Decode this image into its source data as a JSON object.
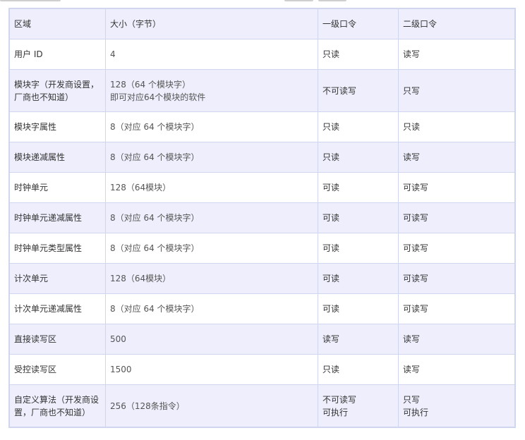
{
  "colors": {
    "header_bg": "#eeeefc",
    "border": "#cfd6ee",
    "text": "#333333"
  },
  "table": {
    "headers": [
      "区域",
      "大小（字节）",
      "一级口令",
      "二级口令"
    ],
    "rows": [
      {
        "area": "用户 ID",
        "size": "4",
        "size2": "",
        "level1": "只读",
        "level1b": "",
        "level2": "读写",
        "level2b": ""
      },
      {
        "area": "模块字（开发商设置，厂商也不知道）",
        "size": "128（64 个模块字）",
        "size2": "即可对应64个模块的软件",
        "level1": "不可读写",
        "level1b": "",
        "level2": "只写",
        "level2b": ""
      },
      {
        "area": "模块字属性",
        "size": "8（对应 64 个模块字）",
        "size2": "",
        "level1": "只读",
        "level1b": "",
        "level2": "只读",
        "level2b": ""
      },
      {
        "area": "模块递减属性",
        "size": "8（对应 64 个模块字）",
        "size2": "",
        "level1": "只读",
        "level1b": "",
        "level2": "读写",
        "level2b": ""
      },
      {
        "area": "时钟单元",
        "size": "128（64模块）",
        "size2": "",
        "level1": "可读",
        "level1b": "",
        "level2": "可读写",
        "level2b": ""
      },
      {
        "area": "时钟单元递减属性",
        "size": "8（对应 64 个模块字）",
        "size2": "",
        "level1": "可读",
        "level1b": "",
        "level2": "可读写",
        "level2b": ""
      },
      {
        "area": "时钟单元类型属性",
        "size": "8（对应 64 个模块字）",
        "size2": "",
        "level1": "可读",
        "level1b": "",
        "level2": "可读写",
        "level2b": ""
      },
      {
        "area": "计次单元",
        "size": "128（64模块）",
        "size2": "",
        "level1": "可读",
        "level1b": "",
        "level2": "可读写",
        "level2b": ""
      },
      {
        "area": "计次单元递减属性",
        "size": "8（对应 64 个模块字）",
        "size2": "",
        "level1": "可读",
        "level1b": "",
        "level2": "可读写",
        "level2b": ""
      },
      {
        "area": "直接读写区",
        "size": "500",
        "size2": "",
        "level1": "读写",
        "level1b": "",
        "level2": "读写",
        "level2b": ""
      },
      {
        "area": "受控读写区",
        "size": "1500",
        "size2": "",
        "level1": "只读",
        "level1b": "",
        "level2": "读写",
        "level2b": ""
      },
      {
        "area": "自定义算法（开发商设置，厂商也不知道）",
        "size": "256（128条指令）",
        "size2": "",
        "level1": "不可读写",
        "level1b": "可执行",
        "level2": "只写",
        "level2b": "可执行"
      }
    ]
  }
}
